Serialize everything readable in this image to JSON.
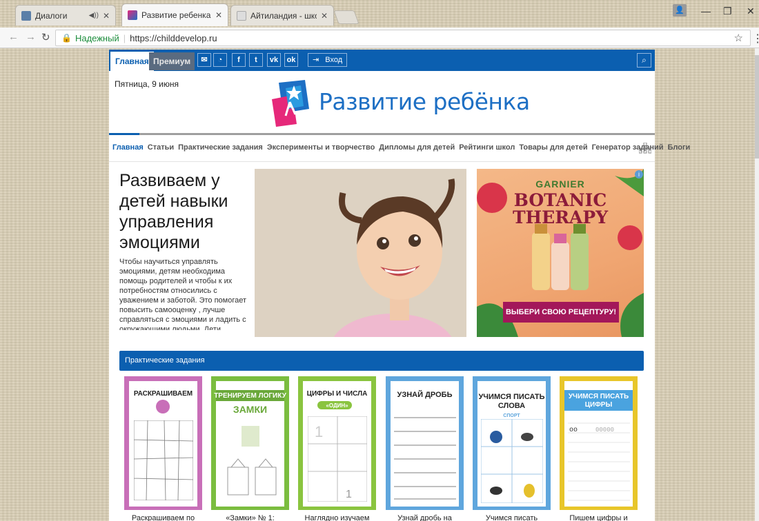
{
  "browser": {
    "tabs": [
      {
        "title": "Диалоги",
        "close": "✕",
        "icon": "dialogs-icon",
        "muted_icon": "speaker-icon"
      },
      {
        "title": "Развитие ребенка - сай",
        "close": "✕",
        "icon": "childdevelop-favicon"
      },
      {
        "title": "Айтиландия - школа пр",
        "close": "✕",
        "icon": "page-icon"
      }
    ],
    "security_label": "Надежный",
    "url": "https://childdevelop.ru"
  },
  "site": {
    "topbar": {
      "home": "Главная",
      "premium": "Премиум",
      "social": [
        "mail-icon",
        "rss-icon",
        "facebook-icon",
        "twitter-icon",
        "vk-icon",
        "odnoklassniki-icon"
      ],
      "login": "Вход"
    },
    "date": "Пятница, 9 июня",
    "logo_text": "Развитие ребёнка",
    "nav": [
      "Главная",
      "Статьи",
      "Практические задания",
      "Эксперименты и творчество",
      "Дипломы для детей",
      "Рейтинги школ",
      "Товары для детей",
      "Генератор заданий",
      "Блоги"
    ],
    "article": {
      "headline": "Развиваем у детей навыки управления эмоциями",
      "lead": "Чтобы научиться управлять эмоциями, детям необходима помощь родителей и чтобы к их потребностям относились с уважением и заботой. Это помогает повысить самооценку , лучше справляться с эмоциями и ладить с окружающими людьми. Дети, имеющие такой опыт, психически здоровы и"
    },
    "ad": {
      "brand": "GARNIER",
      "title_line1": "BOTANIC",
      "title_line2": "THERAPY",
      "cta": "ВЫБЕРИ СВОЮ РЕЦЕПТУРУ!",
      "info": "i"
    },
    "section_title": "Практические задания",
    "cards": [
      {
        "cover_title": "РАСКРАШИВАЕМ",
        "caption": "Раскрашиваем по",
        "color": "#c86fb8"
      },
      {
        "cover_title": "ТРЕНИРУЕМ ЛОГИКУ",
        "cover_sub": "ЗАМКИ",
        "caption": "«Замки» № 1:",
        "color": "#7bbd3f"
      },
      {
        "cover_title": "ЦИФРЫ И ЧИСЛА",
        "cover_sub": "«ОДИН»",
        "caption": "Наглядно изучаем",
        "color": "#8ac43f"
      },
      {
        "cover_title": "УЗНАЙ ДРОБЬ",
        "caption": "Узнай дробь на",
        "color": "#5fa6dd"
      },
      {
        "cover_title": "УЧИМСЯ ПИСАТЬ СЛОВА",
        "cover_sub": "СПОРТ",
        "caption": "Учимся писать",
        "color": "#5fa6dd"
      },
      {
        "cover_title": "УЧИМСЯ ПИСАТЬ ЦИФРЫ",
        "caption": "Пишем цифры и",
        "color": "#e8c62a"
      }
    ]
  }
}
